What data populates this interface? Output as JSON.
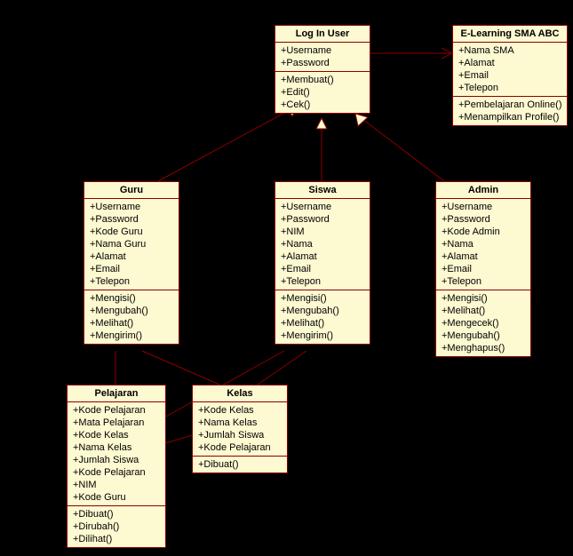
{
  "classes": {
    "login": {
      "title": "Log In User",
      "attrs": [
        "+Username",
        "+Password"
      ],
      "ops": [
        "+Membuat()",
        "+Edit()",
        "+Cek()"
      ]
    },
    "elearning": {
      "title": "E-Learning SMA ABC",
      "attrs": [
        "+Nama SMA",
        "+Alamat",
        "+Email",
        "+Telepon"
      ],
      "ops": [
        "+Pembelajaran Online()",
        "+Menampilkan Profile()"
      ]
    },
    "guru": {
      "title": "Guru",
      "attrs": [
        "+Username",
        "+Password",
        "+Kode Guru",
        "+Nama Guru",
        "+Alamat",
        "+Email",
        "+Telepon"
      ],
      "ops": [
        "+Mengisi()",
        "+Mengubah()",
        "+Melihat()",
        "+Mengirim()"
      ]
    },
    "siswa": {
      "title": "Siswa",
      "attrs": [
        "+Username",
        "+Password",
        "+NIM",
        "+Nama",
        "+Alamat",
        "+Email",
        "+Telepon"
      ],
      "ops": [
        "+Mengisi()",
        "+Mengubah()",
        "+Melihat()",
        "+Mengirim()"
      ]
    },
    "admin": {
      "title": "Admin",
      "attrs": [
        "+Username",
        "+Password",
        "+Kode Admin",
        "+Nama",
        "+Alamat",
        "+Email",
        "+Telepon"
      ],
      "ops": [
        "+Mengisi()",
        "+Melihat()",
        "+Mengecek()",
        "+Mengubah()",
        "+Menghapus()"
      ]
    },
    "pelajaran": {
      "title": "Pelajaran",
      "attrs": [
        "+Kode Pelajaran",
        "+Mata Pelajaran",
        "+Kode Kelas",
        "+Nama Kelas",
        "+Jumlah Siswa",
        "+Kode Pelajaran",
        "+NIM",
        "+Kode Guru"
      ],
      "ops": [
        "+Dibuat()",
        "+Dirubah()",
        "+Dilihat()"
      ]
    },
    "kelas": {
      "title": "Kelas",
      "attrs": [
        "+Kode Kelas",
        "+Nama Kelas",
        "+Jumlah Siswa",
        "+Kode Pelajaran"
      ],
      "ops": [
        "+Dibuat()"
      ]
    }
  }
}
